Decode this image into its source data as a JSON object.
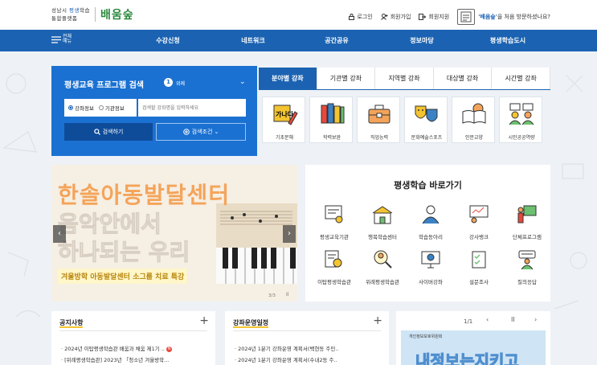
{
  "logo": {
    "line1_prefix": "성남시 ",
    "line1_highlight": "평생",
    "line1_suffix": "학습",
    "line2": "통합플랫폼",
    "brand": "배움숲"
  },
  "util": {
    "login": "로그인",
    "signup": "회원가입",
    "join": "회원지원",
    "welcome_brand": "'배움숲'",
    "welcome_rest": "을 처음 방문하셨나요?"
  },
  "nav": {
    "menu_label": "전체메뉴",
    "items": [
      "수강신청",
      "네트워크",
      "공간공유",
      "정보마당",
      "평생학습도시"
    ]
  },
  "search": {
    "title": "평생교육 프로그램 검색",
    "step_num": "1",
    "step_label": "위례",
    "radio_course": "강좌정보",
    "radio_org": "기관정보",
    "placeholder": "검색할 강좌명을 입력하세요",
    "search_btn": "검색하기",
    "filter_btn": "검색조건"
  },
  "tabs": [
    "분야별 강좌",
    "기관별 강좌",
    "지역별 강좌",
    "대상별 강좌",
    "시간별 강좌"
  ],
  "categories": [
    "기초문해",
    "학력보완",
    "직업능력",
    "문화예술스포츠",
    "인문교양",
    "시민공공역량"
  ],
  "banner": {
    "line1": "한솔아동발달센터",
    "line2": "음악안에서",
    "line3": "하나되는 우리",
    "sub": "겨울방학 아동발달센터 소그룹 치료 특강",
    "page": "3/3",
    "pause": "II"
  },
  "shortcut": {
    "title": "평생학습 바로가기",
    "items": [
      "평생교육기관",
      "행복학습센터",
      "학습동아리",
      "강사뱅크",
      "단체프로그램",
      "이탑평생학습관",
      "위례평생학습관",
      "사이버강좌",
      "설문조사",
      "질의응답"
    ]
  },
  "notice": {
    "title": "공지사항",
    "rows": [
      "2024년 이탑평생학습관 배움과 채움 제1기 ..",
      "[위례평생학습관] 2023년 「청소년 겨울방학..."
    ],
    "badge": "N"
  },
  "schedule": {
    "title": "강좌운영일정",
    "rows": [
      "2024년 1분기 강좌운영 계획서(백현동 주민..",
      "2024년 1분기 강좌운영 계획서(수내2동 주.."
    ]
  },
  "slider": {
    "counter": "1/1",
    "org": "개인정보보호위원회",
    "big": "내정보는지키고"
  }
}
